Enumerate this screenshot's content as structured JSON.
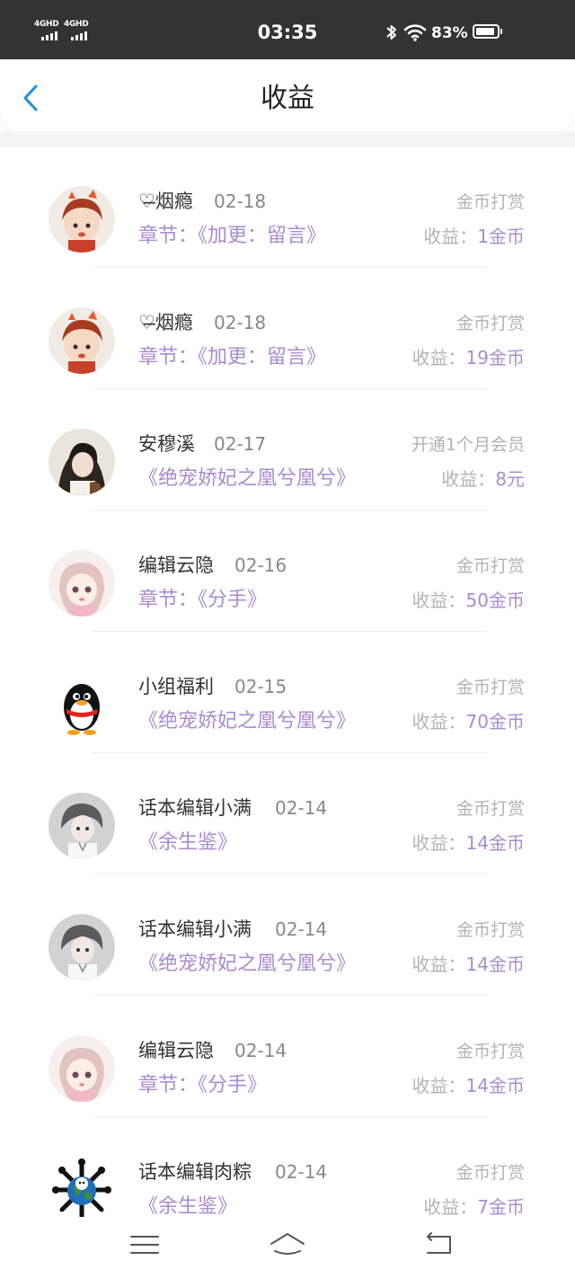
{
  "status_bar": {
    "signal_1": "4GHD",
    "signal_2": "4GHD",
    "time": "03:35",
    "battery": "83%"
  },
  "header": {
    "title": "收益"
  },
  "records": [
    {
      "name": "♡̶烟瘾",
      "date": "02-18",
      "work": "章节：《加更：留言》",
      "type": "金币打赏",
      "earn_label": "收益：",
      "earn_value": "1金币",
      "avatar": "cartoon-girl-avatar"
    },
    {
      "name": "♡̶烟瘾",
      "date": "02-18",
      "work": "章节：《加更：留言》",
      "type": "金币打赏",
      "earn_label": "收益：",
      "earn_value": "19金币",
      "avatar": "cartoon-girl-avatar"
    },
    {
      "name": "安穆溪",
      "date": "02-17",
      "work": "《绝宠娇妃之凰兮凰兮》",
      "type": "开通1个月会员",
      "earn_label": "收益：",
      "earn_value": "8元",
      "avatar": "dark-hair-avatar"
    },
    {
      "name": "编辑云隐",
      "date": "02-16",
      "work": "章节：《分手》",
      "type": "金币打赏",
      "earn_label": "收益：",
      "earn_value": "50金币",
      "avatar": "pink-girl-avatar"
    },
    {
      "name": "小组福利",
      "date": "02-15",
      "work": "《绝宠娇妃之凰兮凰兮》",
      "type": "金币打赏",
      "earn_label": "收益：",
      "earn_value": "70金币",
      "avatar": "penguin-avatar"
    },
    {
      "name": "话本编辑小满",
      "date": "02-14",
      "work": "《余生鉴》",
      "type": "金币打赏",
      "earn_label": "收益：",
      "earn_value": "14金币",
      "avatar": "grey-boy-avatar"
    },
    {
      "name": "话本编辑小满",
      "date": "02-14",
      "work": "《绝宠娇妃之凰兮凰兮》",
      "type": "金币打赏",
      "earn_label": "收益：",
      "earn_value": "14金币",
      "avatar": "grey-boy-avatar"
    },
    {
      "name": "编辑云隐",
      "date": "02-14",
      "work": "章节：《分手》",
      "type": "金币打赏",
      "earn_label": "收益：",
      "earn_value": "14金币",
      "avatar": "pink-girl-avatar"
    },
    {
      "name": "话本编辑肉粽",
      "date": "02-14",
      "work": "《余生鉴》",
      "type": "金币打赏",
      "earn_label": "收益：",
      "earn_value": "7金币",
      "avatar": "globe-avatar"
    }
  ],
  "colors": {
    "accent_purple": "#a98bd2",
    "back_blue": "#1a8fe3",
    "status_bar": "#333333"
  }
}
